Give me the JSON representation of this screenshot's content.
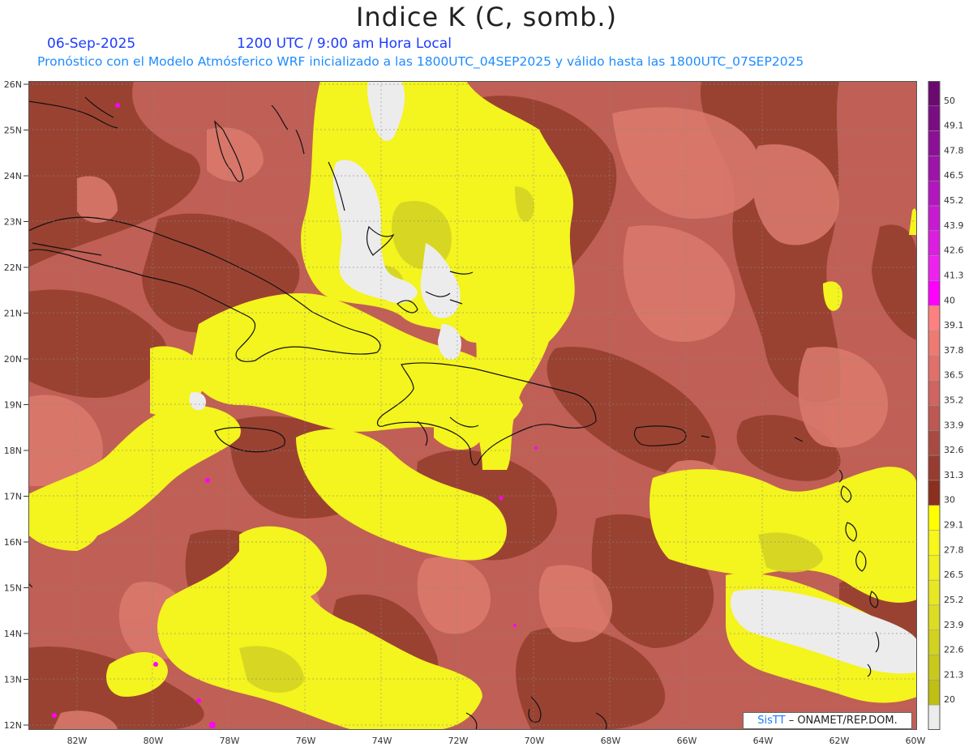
{
  "header": {
    "title": "Indice K (C, somb.)",
    "date": "06-Sep-2025",
    "time": "1200 UTC / 9:00 am Hora Local",
    "forecast_line": "Pronóstico con el Modelo Atmósferico WRF inicializado a las 1800UTC_04SEP2025 y válido hasta las  1800UTC_07SEP2025"
  },
  "map": {
    "lat_labels": [
      "26N",
      "25N",
      "24N",
      "23N",
      "22N",
      "21N",
      "20N",
      "19N",
      "18N",
      "17N",
      "16N",
      "15N",
      "14N",
      "13N",
      "12N"
    ],
    "lon_labels": [
      "82W",
      "80W",
      "78W",
      "76W",
      "74W",
      "72W",
      "70W",
      "68W",
      "66W",
      "64W",
      "62W",
      "60W"
    ],
    "colors": {
      "base": "#c05f55",
      "dark": "#9a4232",
      "light": "#dc7a6e",
      "yellow": "#f4f41e",
      "olive": "#d4d424",
      "gray": "#ececec",
      "coast": "#111111"
    }
  },
  "legend": {
    "levels": [
      {
        "label": "50",
        "color": "#6a0a6e"
      },
      {
        "label": "49.1",
        "color": "#7a0d82"
      },
      {
        "label": "47.8",
        "color": "#8b1096"
      },
      {
        "label": "46.5",
        "color": "#9e13aa"
      },
      {
        "label": "45.2",
        "color": "#b316bf"
      },
      {
        "label": "43.9",
        "color": "#c81ad0"
      },
      {
        "label": "42.6",
        "color": "#dc1ee0"
      },
      {
        "label": "41.3",
        "color": "#ee22ee"
      },
      {
        "label": "40",
        "color": "#ff00ff"
      },
      {
        "label": "39.1",
        "color": "#ff8080"
      },
      {
        "label": "37.8",
        "color": "#ef7a72"
      },
      {
        "label": "36.5",
        "color": "#e0706a"
      },
      {
        "label": "35.2",
        "color": "#cf6460"
      },
      {
        "label": "33.9",
        "color": "#bd5852"
      },
      {
        "label": "32.6",
        "color": "#a84a42"
      },
      {
        "label": "31.3",
        "color": "#973c30"
      },
      {
        "label": "30",
        "color": "#8b2f1e"
      },
      {
        "label": "29.1",
        "color": "#ffff00"
      },
      {
        "label": "27.8",
        "color": "#f7f71a"
      },
      {
        "label": "26.5",
        "color": "#efef22"
      },
      {
        "label": "25.2",
        "color": "#e7e724"
      },
      {
        "label": "23.9",
        "color": "#dcdc24"
      },
      {
        "label": "22.6",
        "color": "#d2d220"
      },
      {
        "label": "21.3",
        "color": "#c9c91c"
      },
      {
        "label": "20",
        "color": "#bfbf14"
      },
      {
        "label": "",
        "color": "#ececec"
      }
    ]
  },
  "credit": {
    "brand": "SisTT",
    "org": " – ONAMET/REP.DOM."
  }
}
